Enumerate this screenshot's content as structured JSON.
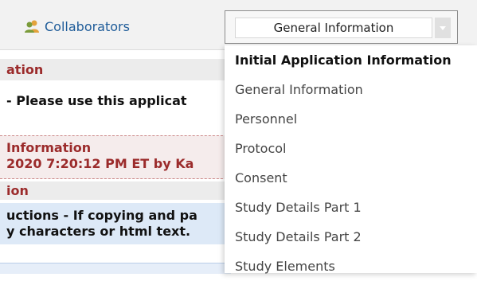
{
  "toolbar": {
    "collaborators_label": "Collaborators",
    "collaborators_icon": "people-icon"
  },
  "form_select": {
    "selected_value": "General Information",
    "arrow_icon": "chevron-down-icon"
  },
  "background_page": {
    "section_title": "ation",
    "instruction_text": " - Please use this applicat",
    "info_block": {
      "title": " Information",
      "updated_line": "2020 7:20:12 PM ET by Ka"
    },
    "subsection_title": "ion",
    "notice_lines": [
      "uctions - If copying and pa",
      "y characters or html text."
    ]
  },
  "dropdown": {
    "options": [
      "Initial Application Information",
      "General Information",
      "Personnel",
      "Protocol",
      "Consent",
      "Study Details Part 1",
      "Study Details Part 2",
      "Study Elements"
    ],
    "group_header_index": 0
  },
  "colors": {
    "link_blue": "#1f5c99",
    "section_red": "#9b2b2b",
    "notice_blue": "#dde9f7"
  }
}
